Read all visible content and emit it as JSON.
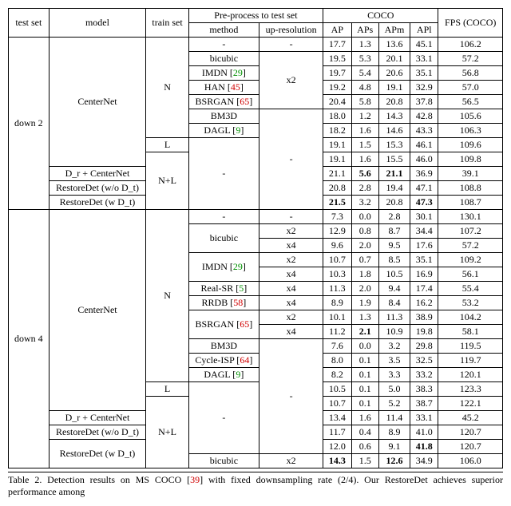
{
  "headers": {
    "test_set": "test set",
    "model": "model",
    "train_set": "train set",
    "preprocess": "Pre-process to test set",
    "method": "method",
    "upres": "up-resolution",
    "coco": "COCO",
    "ap": "AP",
    "aps": "APs",
    "apm": "APm",
    "apl": "APl",
    "fps": "FPS (COCO)"
  },
  "testsets": {
    "d2": "down 2",
    "d4": "down 4"
  },
  "trainsets": {
    "n": "N",
    "l": "L",
    "nl": "N+L"
  },
  "models": {
    "centernet": "CenterNet",
    "dr_center": "D_r + CenterNet",
    "rd_wo": "RestoreDet (w/o D_t)",
    "rd_w": "RestoreDet (w D_t)"
  },
  "methods": {
    "dash": "-",
    "bicubic": "bicubic",
    "imdn": "IMDN [",
    "imdn_ref": "29",
    "han": "HAN [",
    "han_ref": "45",
    "bsrgan": "BSRGAN [",
    "bsrgan_ref": "65",
    "bm3d": "BM3D",
    "dagl": "DAGL [",
    "dagl_ref": "9",
    "realsr": "Real-SR [",
    "realsr_ref": "5",
    "rrdb": "RRDB [",
    "rrdb_ref": "58",
    "cycleisp": "Cycle-ISP [",
    "cycleisp_ref": "64",
    "close": "]"
  },
  "upres": {
    "dash": "-",
    "x2": "x2",
    "x4": "x4"
  },
  "d2_rows": {
    "r1": {
      "ap": "17.7",
      "aps": "1.3",
      "apm": "13.6",
      "apl": "45.1",
      "fps": "106.2"
    },
    "r2": {
      "ap": "19.5",
      "aps": "5.3",
      "apm": "20.1",
      "apl": "33.1",
      "fps": "57.2"
    },
    "r3": {
      "ap": "19.7",
      "aps": "5.4",
      "apm": "20.6",
      "apl": "35.1",
      "fps": "56.8"
    },
    "r4": {
      "ap": "19.2",
      "aps": "4.8",
      "apm": "19.1",
      "apl": "32.9",
      "fps": "57.0"
    },
    "r5": {
      "ap": "20.4",
      "aps": "5.8",
      "apm": "20.8",
      "apl": "37.8",
      "fps": "56.5"
    },
    "r6": {
      "ap": "18.0",
      "aps": "1.2",
      "apm": "14.3",
      "apl": "42.8",
      "fps": "105.6"
    },
    "r7": {
      "ap": "18.2",
      "aps": "1.6",
      "apm": "14.6",
      "apl": "43.3",
      "fps": "106.3"
    },
    "r8": {
      "ap": "19.1",
      "aps": "1.5",
      "apm": "15.3",
      "apl": "46.1",
      "fps": "109.6"
    },
    "r9": {
      "ap": "19.1",
      "aps": "1.6",
      "apm": "15.5",
      "apl": "46.0",
      "fps": "109.8"
    },
    "r10": {
      "ap": "21.1",
      "aps": "5.6",
      "apm": "21.1",
      "apl": "36.9",
      "fps": "39.1"
    },
    "r11": {
      "ap": "20.8",
      "aps": "2.8",
      "apm": "19.4",
      "apl": "47.1",
      "fps": "108.8"
    },
    "r12": {
      "ap": "21.5",
      "aps": "3.2",
      "apm": "20.8",
      "apl": "47.3",
      "fps": "108.7"
    }
  },
  "d4_rows": {
    "r1": {
      "ap": "7.3",
      "aps": "0.0",
      "apm": "2.8",
      "apl": "30.1",
      "fps": "130.1"
    },
    "r2": {
      "ap": "12.9",
      "aps": "0.8",
      "apm": "8.7",
      "apl": "34.4",
      "fps": "107.2"
    },
    "r3": {
      "ap": "9.6",
      "aps": "2.0",
      "apm": "9.5",
      "apl": "17.6",
      "fps": "57.2"
    },
    "r4": {
      "ap": "10.7",
      "aps": "0.7",
      "apm": "8.5",
      "apl": "35.1",
      "fps": "109.2"
    },
    "r5": {
      "ap": "10.3",
      "aps": "1.8",
      "apm": "10.5",
      "apl": "16.9",
      "fps": "56.1"
    },
    "r6": {
      "ap": "11.3",
      "aps": "2.0",
      "apm": "9.4",
      "apl": "17.4",
      "fps": "55.4"
    },
    "r7": {
      "ap": "8.9",
      "aps": "1.9",
      "apm": "8.4",
      "apl": "16.2",
      "fps": "53.2"
    },
    "r8": {
      "ap": "10.1",
      "aps": "1.3",
      "apm": "11.3",
      "apl": "38.9",
      "fps": "104.2"
    },
    "r9": {
      "ap": "11.2",
      "aps": "2.1",
      "apm": "10.9",
      "apl": "19.8",
      "fps": "58.1"
    },
    "r10": {
      "ap": "7.6",
      "aps": "0.0",
      "apm": "3.2",
      "apl": "29.8",
      "fps": "119.5"
    },
    "r11": {
      "ap": "8.0",
      "aps": "0.1",
      "apm": "3.5",
      "apl": "32.5",
      "fps": "119.7"
    },
    "r12": {
      "ap": "8.2",
      "aps": "0.1",
      "apm": "3.3",
      "apl": "33.2",
      "fps": "120.1"
    },
    "r13": {
      "ap": "10.5",
      "aps": "0.1",
      "apm": "5.0",
      "apl": "38.3",
      "fps": "123.3"
    },
    "r14": {
      "ap": "10.7",
      "aps": "0.1",
      "apm": "5.2",
      "apl": "38.7",
      "fps": "122.1"
    },
    "r15": {
      "ap": "13.4",
      "aps": "1.6",
      "apm": "11.4",
      "apl": "33.1",
      "fps": "45.2"
    },
    "r16": {
      "ap": "11.7",
      "aps": "0.4",
      "apm": "8.9",
      "apl": "41.0",
      "fps": "120.7"
    },
    "r17": {
      "ap": "12.0",
      "aps": "0.6",
      "apm": "9.1",
      "apl": "41.8",
      "fps": "120.7"
    },
    "r18": {
      "ap": "14.3",
      "aps": "1.5",
      "apm": "12.6",
      "apl": "34.9",
      "fps": "106.0"
    }
  },
  "caption_parts": {
    "p1": "Table 2. Detection results on MS COCO [",
    "ref": "39",
    "p2": "] with fixed downsampling rate (2/4). Our RestoreDet achieves superior performance among"
  },
  "chart_data": {
    "type": "table",
    "title": "Detection results on MS COCO with fixed downsampling rate (2/4)",
    "sections": [
      {
        "test_set": "down 2",
        "rows": [
          {
            "model": "CenterNet",
            "train_set": "N",
            "method": "-",
            "up": "-",
            "AP": 17.7,
            "APs": 1.3,
            "APm": 13.6,
            "APl": 45.1,
            "FPS": 106.2
          },
          {
            "model": "CenterNet",
            "train_set": "N",
            "method": "bicubic",
            "up": "x2",
            "AP": 19.5,
            "APs": 5.3,
            "APm": 20.1,
            "APl": 33.1,
            "FPS": 57.2
          },
          {
            "model": "CenterNet",
            "train_set": "N",
            "method": "IMDN",
            "up": "x2",
            "AP": 19.7,
            "APs": 5.4,
            "APm": 20.6,
            "APl": 35.1,
            "FPS": 56.8
          },
          {
            "model": "CenterNet",
            "train_set": "N",
            "method": "HAN",
            "up": "x2",
            "AP": 19.2,
            "APs": 4.8,
            "APm": 19.1,
            "APl": 32.9,
            "FPS": 57.0
          },
          {
            "model": "CenterNet",
            "train_set": "N",
            "method": "BSRGAN",
            "up": "x2",
            "AP": 20.4,
            "APs": 5.8,
            "APm": 20.8,
            "APl": 37.8,
            "FPS": 56.5
          },
          {
            "model": "CenterNet",
            "train_set": "N",
            "method": "BM3D",
            "up": "-",
            "AP": 18.0,
            "APs": 1.2,
            "APm": 14.3,
            "APl": 42.8,
            "FPS": 105.6
          },
          {
            "model": "CenterNet",
            "train_set": "N",
            "method": "DAGL",
            "up": "-",
            "AP": 18.2,
            "APs": 1.6,
            "APm": 14.6,
            "APl": 43.3,
            "FPS": 106.3
          },
          {
            "model": "CenterNet",
            "train_set": "L",
            "method": "-",
            "up": "-",
            "AP": 19.1,
            "APs": 1.5,
            "APm": 15.3,
            "APl": 46.1,
            "FPS": 109.6
          },
          {
            "model": "CenterNet",
            "train_set": "N+L",
            "method": "-",
            "up": "-",
            "AP": 19.1,
            "APs": 1.6,
            "APm": 15.5,
            "APl": 46.0,
            "FPS": 109.8
          },
          {
            "model": "Dr+CenterNet",
            "train_set": "N+L",
            "method": "-",
            "up": "-",
            "AP": 21.1,
            "APs": 5.6,
            "APm": 21.1,
            "APl": 36.9,
            "FPS": 39.1
          },
          {
            "model": "RestoreDet(w/o Dt)",
            "train_set": "N+L",
            "method": "-",
            "up": "-",
            "AP": 20.8,
            "APs": 2.8,
            "APm": 19.4,
            "APl": 47.1,
            "FPS": 108.8
          },
          {
            "model": "RestoreDet(w Dt)",
            "train_set": "N+L",
            "method": "-",
            "up": "-",
            "AP": 21.5,
            "APs": 3.2,
            "APm": 20.8,
            "APl": 47.3,
            "FPS": 108.7
          }
        ]
      },
      {
        "test_set": "down 4",
        "rows": [
          {
            "model": "CenterNet",
            "train_set": "N",
            "method": "-",
            "up": "-",
            "AP": 7.3,
            "APs": 0.0,
            "APm": 2.8,
            "APl": 30.1,
            "FPS": 130.1
          },
          {
            "model": "CenterNet",
            "train_set": "N",
            "method": "bicubic",
            "up": "x2",
            "AP": 12.9,
            "APs": 0.8,
            "APm": 8.7,
            "APl": 34.4,
            "FPS": 107.2
          },
          {
            "model": "CenterNet",
            "train_set": "N",
            "method": "bicubic",
            "up": "x4",
            "AP": 9.6,
            "APs": 2.0,
            "APm": 9.5,
            "APl": 17.6,
            "FPS": 57.2
          },
          {
            "model": "CenterNet",
            "train_set": "N",
            "method": "IMDN",
            "up": "x2",
            "AP": 10.7,
            "APs": 0.7,
            "APm": 8.5,
            "APl": 35.1,
            "FPS": 109.2
          },
          {
            "model": "CenterNet",
            "train_set": "N",
            "method": "IMDN",
            "up": "x4",
            "AP": 10.3,
            "APs": 1.8,
            "APm": 10.5,
            "APl": 16.9,
            "FPS": 56.1
          },
          {
            "model": "CenterNet",
            "train_set": "N",
            "method": "Real-SR",
            "up": "x4",
            "AP": 11.3,
            "APs": 2.0,
            "APm": 9.4,
            "APl": 17.4,
            "FPS": 55.4
          },
          {
            "model": "CenterNet",
            "train_set": "N",
            "method": "RRDB",
            "up": "x4",
            "AP": 8.9,
            "APs": 1.9,
            "APm": 8.4,
            "APl": 16.2,
            "FPS": 53.2
          },
          {
            "model": "CenterNet",
            "train_set": "N",
            "method": "BSRGAN",
            "up": "x2",
            "AP": 10.1,
            "APs": 1.3,
            "APm": 11.3,
            "APl": 38.9,
            "FPS": 104.2
          },
          {
            "model": "CenterNet",
            "train_set": "N",
            "method": "BSRGAN",
            "up": "x4",
            "AP": 11.2,
            "APs": 2.1,
            "APm": 10.9,
            "APl": 19.8,
            "FPS": 58.1
          },
          {
            "model": "CenterNet",
            "train_set": "N",
            "method": "BM3D",
            "up": "-",
            "AP": 7.6,
            "APs": 0.0,
            "APm": 3.2,
            "APl": 29.8,
            "FPS": 119.5
          },
          {
            "model": "CenterNet",
            "train_set": "N",
            "method": "Cycle-ISP",
            "up": "-",
            "AP": 8.0,
            "APs": 0.1,
            "APm": 3.5,
            "APl": 32.5,
            "FPS": 119.7
          },
          {
            "model": "CenterNet",
            "train_set": "N",
            "method": "DAGL",
            "up": "-",
            "AP": 8.2,
            "APs": 0.1,
            "APm": 3.3,
            "APl": 33.2,
            "FPS": 120.1
          },
          {
            "model": "CenterNet",
            "train_set": "L",
            "method": "-",
            "up": "-",
            "AP": 10.5,
            "APs": 0.1,
            "APm": 5.0,
            "APl": 38.3,
            "FPS": 123.3
          },
          {
            "model": "CenterNet",
            "train_set": "N+L",
            "method": "-",
            "up": "-",
            "AP": 10.7,
            "APs": 0.1,
            "APm": 5.2,
            "APl": 38.7,
            "FPS": 122.1
          },
          {
            "model": "Dr+CenterNet",
            "train_set": "N+L",
            "method": "-",
            "up": "-",
            "AP": 13.4,
            "APs": 1.6,
            "APm": 11.4,
            "APl": 33.1,
            "FPS": 45.2
          },
          {
            "model": "RestoreDet(w/o Dt)",
            "train_set": "N+L",
            "method": "-",
            "up": "-",
            "AP": 11.7,
            "APs": 0.4,
            "APm": 8.9,
            "APl": 41.0,
            "FPS": 120.7
          },
          {
            "model": "RestoreDet(w Dt)",
            "train_set": "N+L",
            "method": "-",
            "up": "-",
            "AP": 12.0,
            "APs": 0.6,
            "APm": 9.1,
            "APl": 41.8,
            "FPS": 120.7
          },
          {
            "model": "RestoreDet(w Dt)",
            "train_set": "N+L",
            "method": "bicubic",
            "up": "x2",
            "AP": 14.3,
            "APs": 1.5,
            "APm": 12.6,
            "APl": 34.9,
            "FPS": 106.0
          }
        ]
      }
    ]
  }
}
